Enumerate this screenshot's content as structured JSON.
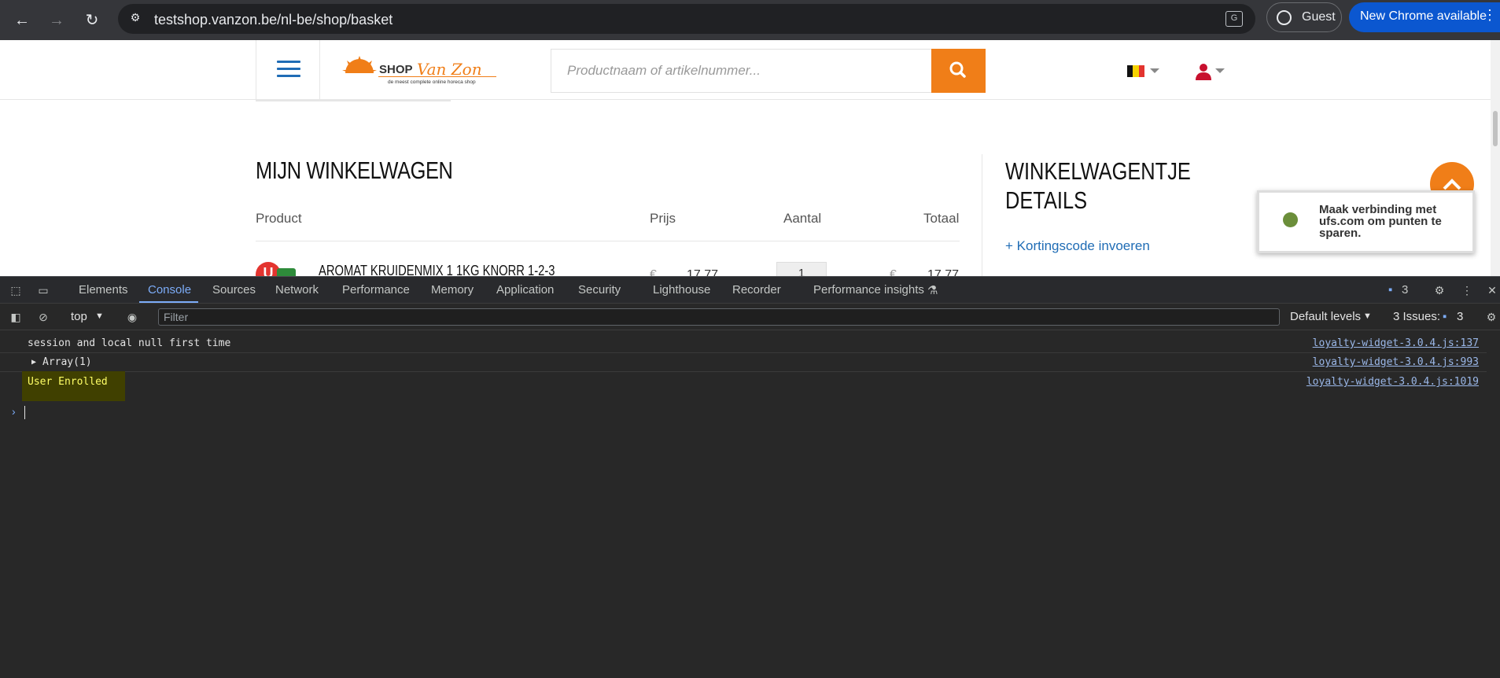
{
  "browser": {
    "url": "testshop.vanzon.be/nl-be/shop/basket",
    "guest_label": "Guest",
    "update_label": "New Chrome available"
  },
  "site": {
    "search_placeholder": "Productnaam of artikelnummer...",
    "cart_title": "MIJN WINKELWAGEN",
    "columns": {
      "product": "Product",
      "price": "Prijs",
      "quantity": "Aantal",
      "total": "Totaal"
    },
    "item": {
      "name": "AROMAT KRUIDENMIX 1 1KG KNORR 1-2-3",
      "currency": "€",
      "price": "17,77",
      "quantity": "1",
      "total": "17,77"
    },
    "details_title_line1": "WINKELWAGENTJE",
    "details_title_line2": "DETAILS",
    "discount_link": "+ Kortingscode invoeren",
    "loyalty_text": "Maak verbinding met ufs.com om punten te sparen.",
    "brand_colors": {
      "accent": "#f07e18",
      "link": "#1f6cb5"
    }
  },
  "devtools": {
    "tabs": [
      "Elements",
      "Console",
      "Sources",
      "Network",
      "Performance",
      "Memory",
      "Application",
      "Security",
      "Lighthouse",
      "Recorder",
      "Performance insights"
    ],
    "active_tab": "Console",
    "issues_badge": "3",
    "context": "top",
    "filter_placeholder": "Filter",
    "levels": "Default levels",
    "issues_label": "3 Issues:",
    "issues_count": "3",
    "logs": [
      {
        "message": "session and local null first time",
        "source": "loyalty-widget-3.0.4.js:137"
      },
      {
        "message": "Array(1)",
        "source": "loyalty-widget-3.0.4.js:993"
      },
      {
        "message": "User Enrolled",
        "source": "loyalty-widget-3.0.4.js:1019"
      }
    ]
  }
}
